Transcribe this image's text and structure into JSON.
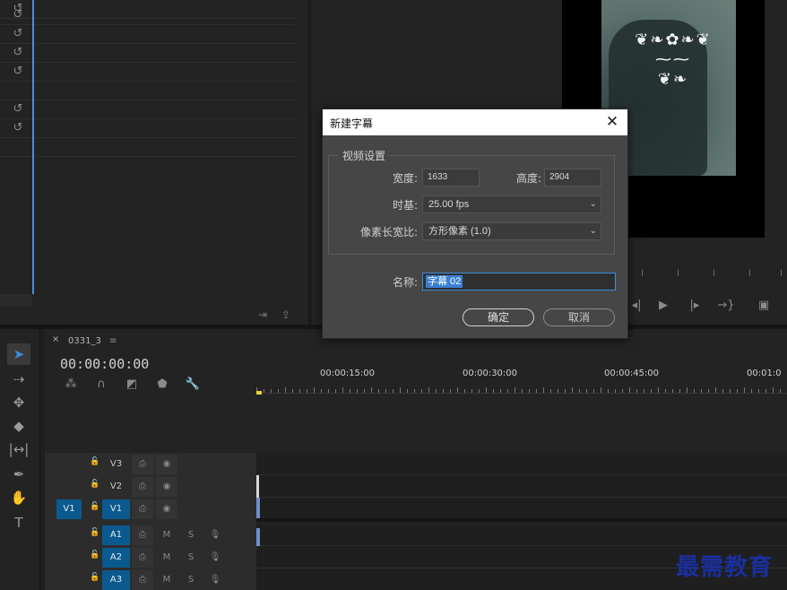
{
  "dialog": {
    "title": "新建字幕",
    "close_icon": "close-icon",
    "group_label": "视频设置",
    "width_label": "宽度:",
    "width_value": "1633",
    "height_label": "高度:",
    "height_value": "2904",
    "timebase_label": "时基:",
    "timebase_value": "25.00 fps",
    "pixel_aspect_label": "像素长宽比:",
    "pixel_aspect_value": "方形像素 (1.0)",
    "name_label": "名称:",
    "name_value": "字幕 02",
    "ok_label": "确定",
    "cancel_label": "取消"
  },
  "timeline": {
    "tab_close": "×",
    "sequence_name": "0331_3",
    "tab_menu": "≡",
    "timecode": "00:00:00:00",
    "ruler_labels": [
      "00:00:15:00",
      "00:00:30:00",
      "00:00:45:00",
      "00:01:0"
    ],
    "tracks": [
      {
        "name": "V3",
        "source_patch": "",
        "targeted": false,
        "lock": "lock-icon",
        "btn1": "sync-lock-icon",
        "btn2": "eye-icon"
      },
      {
        "name": "V2",
        "source_patch": "",
        "targeted": false,
        "lock": "lock-icon",
        "btn1": "sync-lock-icon",
        "btn2": "eye-icon"
      },
      {
        "name": "V1",
        "source_patch": "V1",
        "targeted": true,
        "lock": "lock-icon",
        "btn1": "sync-lock-icon",
        "btn2": "eye-icon"
      },
      {
        "name": "A1",
        "source_patch": "",
        "targeted": true,
        "lock": "lock-icon",
        "btn1": "sync-lock-icon",
        "mute": "M",
        "solo": "S"
      },
      {
        "name": "A2",
        "source_patch": "",
        "targeted": true,
        "lock": "lock-icon",
        "btn1": "sync-lock-icon",
        "mute": "M",
        "solo": "S"
      },
      {
        "name": "A3",
        "source_patch": "",
        "targeted": true,
        "lock": "lock-icon",
        "btn1": "sync-lock-icon",
        "mute": "M",
        "solo": "S"
      }
    ]
  },
  "tools": [
    "selection-tool-icon",
    "track-select-icon",
    "ripple-edit-icon",
    "razor-icon",
    "slip-icon",
    "pen-icon",
    "hand-icon",
    "type-tool-icon"
  ],
  "program_monitor": {
    "transport": [
      "step-back-icon",
      "play-icon",
      "step-forward-icon",
      "go-to-out-icon",
      "export-frame-icon"
    ]
  },
  "watermark": "最需教育",
  "colors": {
    "accent": "#3a8ddf",
    "track_target": "#0b5a8f",
    "dialog_bg": "#464646",
    "panel_bg": "#232323"
  }
}
